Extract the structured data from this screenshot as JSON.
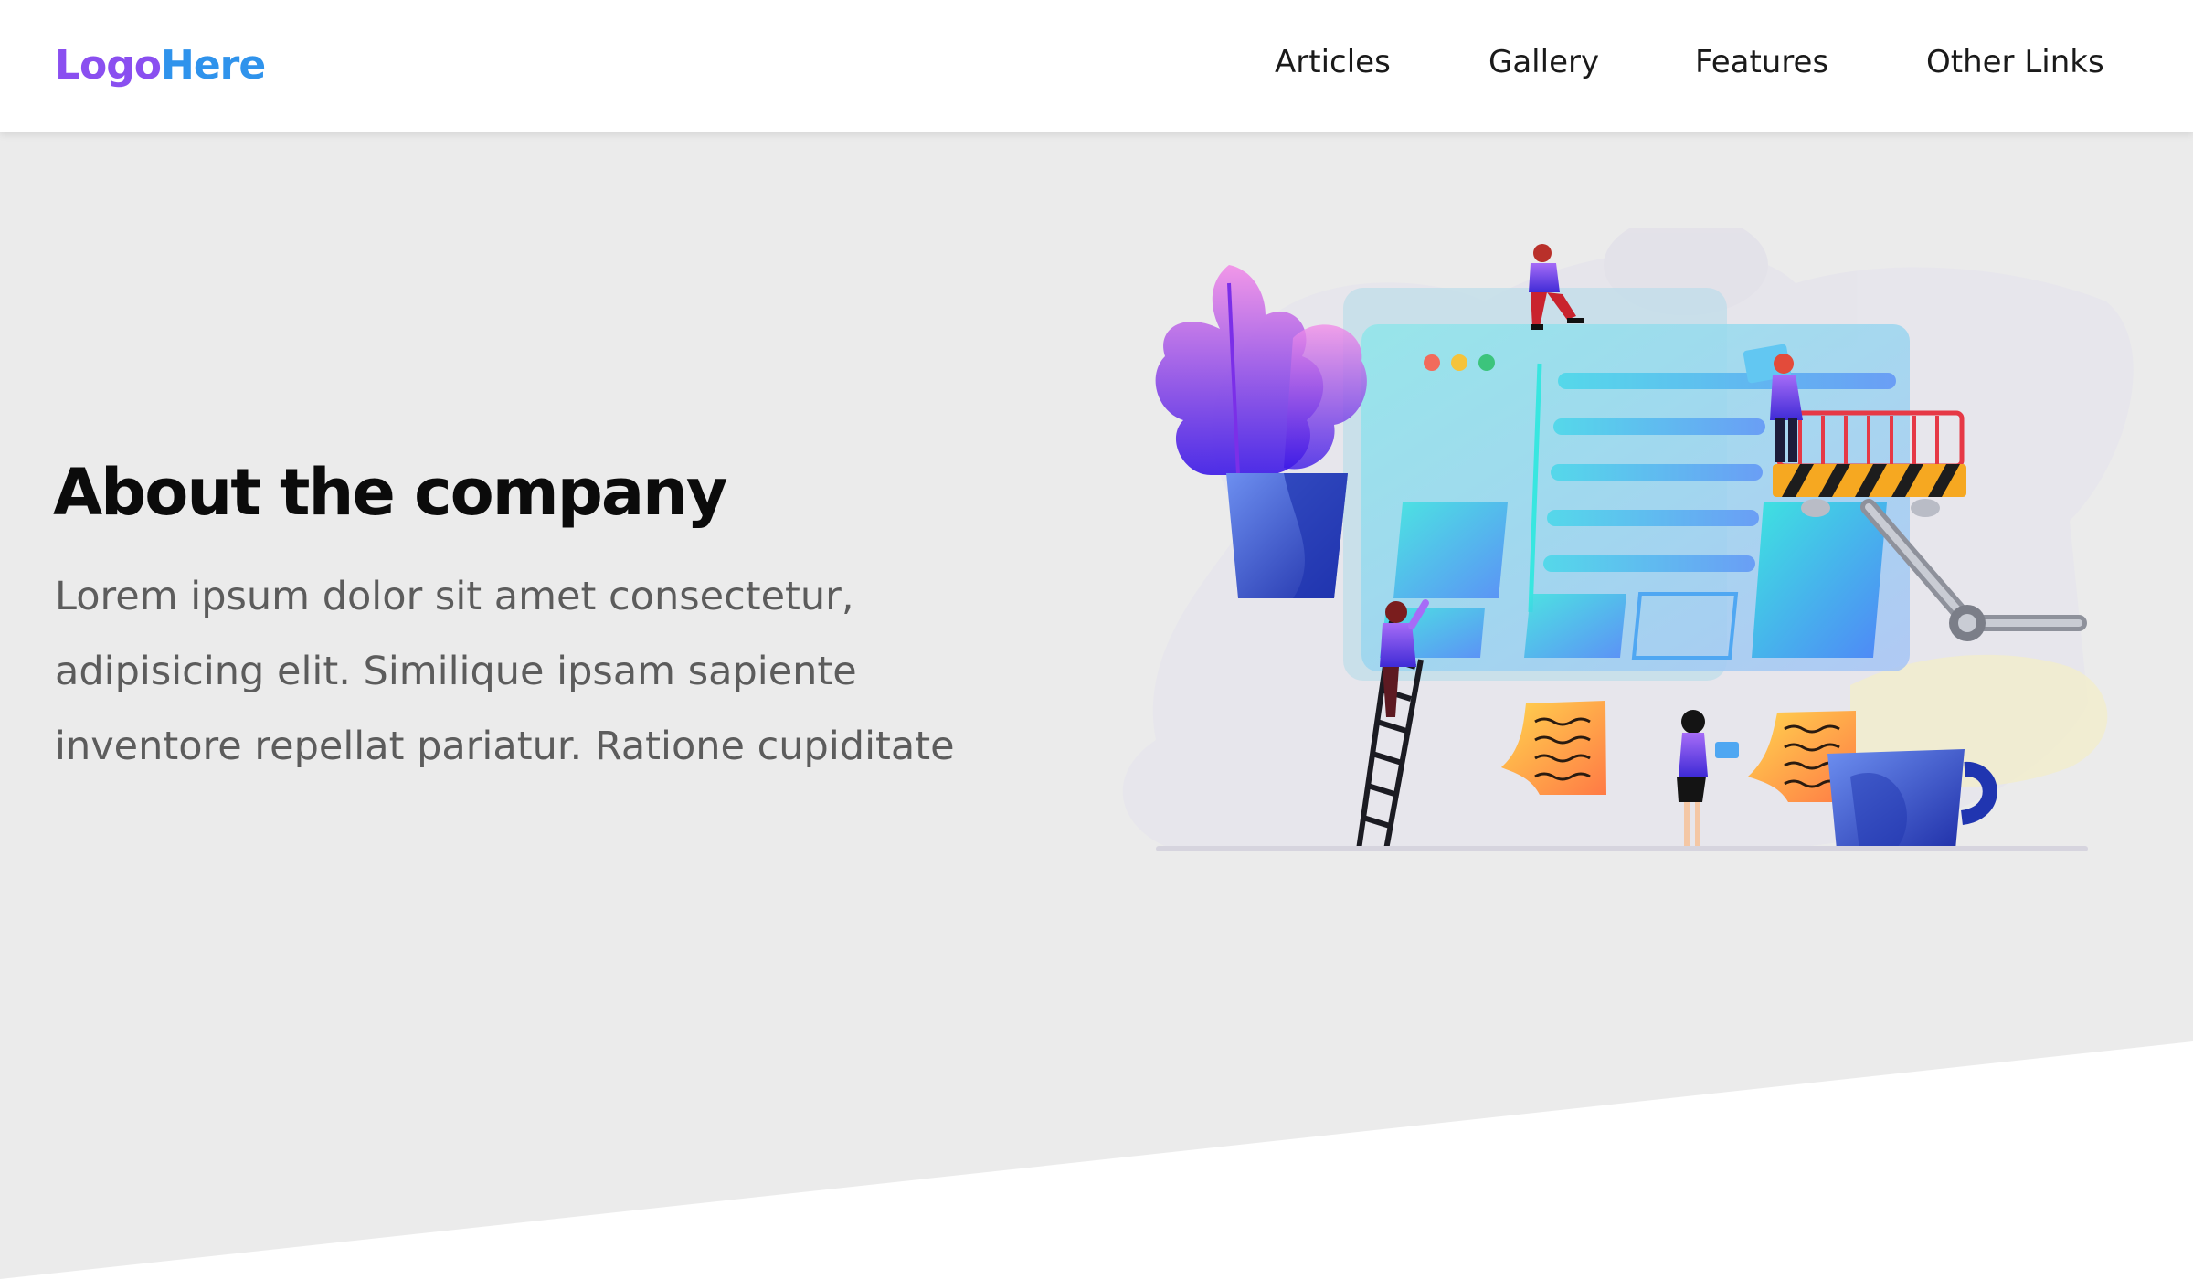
{
  "header": {
    "logo_part1": "Logo",
    "logo_part2": "Here",
    "nav": [
      "Articles",
      "Gallery",
      "Features",
      "Other Links"
    ]
  },
  "hero": {
    "title": "About the company",
    "text": "Lorem ipsum dolor sit amet consectetur, adipisicing elit. Similique ipsam sapiente inventore repellat pariatur. Ratione cupiditate"
  },
  "colors": {
    "background": "#ebebeb",
    "header_bg": "#ffffff",
    "logo_purple": "#8a4ff0",
    "logo_blue": "#2f93ec",
    "title": "#0b0b0b",
    "body_text": "#5c5c5c"
  },
  "illustration": {
    "name": "team-building-website-illustration"
  }
}
